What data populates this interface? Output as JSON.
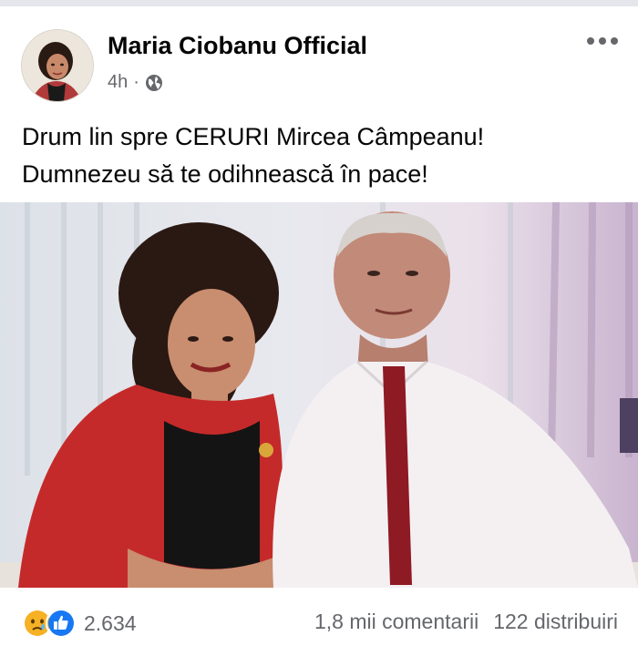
{
  "post": {
    "author": "Maria Ciobanu Official",
    "time": "4h",
    "separator": "·",
    "audience_icon": "globe-icon",
    "text_line1": "Drum lin spre CERURI Mircea Câmpeanu!",
    "text_line2": "Dumnezeu să te odihnească în pace!"
  },
  "footer": {
    "reaction_icons": [
      "sad-reaction-icon",
      "like-reaction-icon"
    ],
    "reaction_count": "2.634",
    "comments": "1,8 mii comentarii",
    "shares": "122 distribuiri"
  },
  "colors": {
    "text": "#050505",
    "secondary": "#65676b",
    "like_blue": "#1877f2",
    "sad_yellow": "#f7b125"
  }
}
